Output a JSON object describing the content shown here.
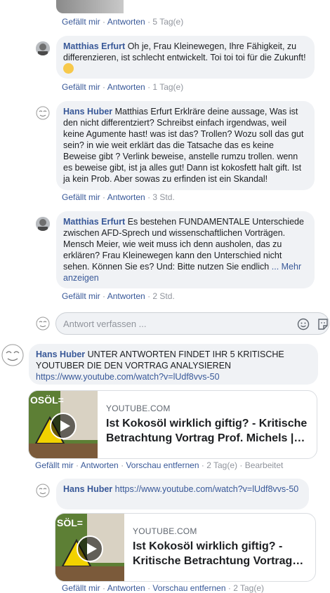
{
  "top_actions": {
    "like": "Gefällt mir",
    "reply": "Antworten",
    "time": "5 Tag(e)"
  },
  "comments": [
    {
      "author": "Matthias Erfurt",
      "text": "Oh je, Frau Kleinewegen, Ihre Fähigkeit, zu differenzieren, ist schlecht entwickelt. Toi toi toi für die Zukunft!",
      "actions": {
        "like": "Gefällt mir",
        "reply": "Antworten",
        "time": "1 Tag(e)"
      }
    },
    {
      "author": "Hans Huber",
      "text": "Matthias Erfurt Erklräre deine aussage, Was ist den nicht differentziert? Schreibst einfach irgendwas, weil keine Agumente hast! was ist das? Trollen? Wozu soll das gut sein? in wie weit erklärt das die Tatsache das es keine Beweise gibt ? Verlink beweise, anstelle rumzu trollen. wenn es beweise gibt, ist ja alles gut! Dann ist kokosfett halt gift. Ist ja kein Prob. Aber sowas zu erfinden ist ein Skandal!",
      "actions": {
        "like": "Gefällt mir",
        "reply": "Antworten",
        "time": "3 Std."
      }
    },
    {
      "author": "Matthias Erfurt",
      "text": "Es bestehen FUNDAMENTALE Unterschiede zwischen AFD-Sprech und wissenschaftlichen Vorträgen. Mensch Meier, wie weit muss ich denn ausholen, das zu erklären? Frau Kleinewegen kann den Unterschied nicht sehen. Können Sie es? Und: Bitte nutzen Sie endlich",
      "more": "... Mehr anzeigen",
      "actions": {
        "like": "Gefällt mir",
        "reply": "Antworten",
        "time": "2 Std."
      }
    }
  ],
  "reply_input": {
    "placeholder": "Antwort verfassen ..."
  },
  "main_comment": {
    "author": "Hans Huber",
    "text": "UNTER ANTWORTEN FINDET IHR 5 KRITISCHE YOUTUBER DIE DEN VORTRAG ANALYSIEREN",
    "url": "https://www.youtube.com/watch?v=lUdf8vvs-50",
    "card": {
      "domain": "YOUTUBE.COM",
      "title": "Ist Kokosöl wirklich giftig? - Kritische Betrachtung Vortrag Prof. Michels |…",
      "thumb_text": "OSÖL="
    },
    "actions": {
      "like": "Gefällt mir",
      "reply": "Antworten",
      "remove_preview": "Vorschau entfernen",
      "time": "2 Tag(e)",
      "edited": "Bearbeitet"
    }
  },
  "reply_comment": {
    "author": "Hans Huber",
    "url": "https://www.youtube.com/watch?v=lUdf8vvs-50",
    "card": {
      "domain": "YOUTUBE.COM",
      "title": "Ist Kokosöl wirklich giftig? - Kritische Betrachtung Vortrag…",
      "thumb_text": "SÖL="
    },
    "actions": {
      "like": "Gefällt mir",
      "reply": "Antworten",
      "remove_preview": "Vorschau entfernen",
      "time": "2 Tag(e)"
    }
  }
}
